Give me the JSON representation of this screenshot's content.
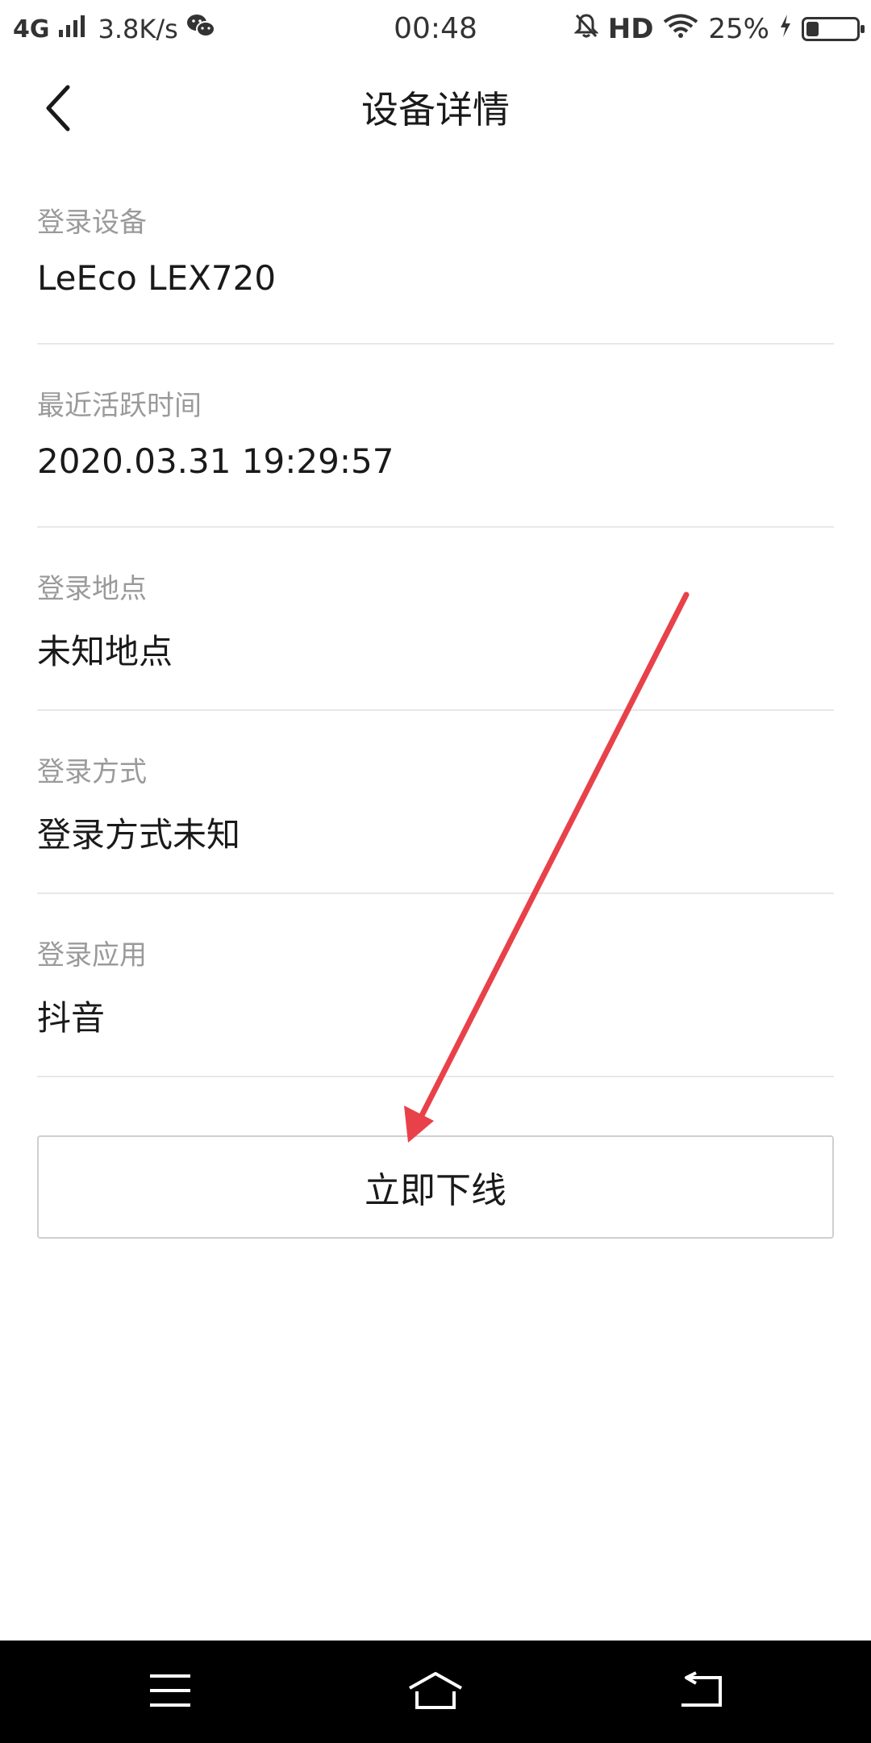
{
  "status_bar": {
    "network": "4G",
    "speed": "3.8K/s",
    "time": "00:48",
    "hd": "HD",
    "battery": "25%",
    "battery_level": 0.25
  },
  "header": {
    "title": "设备详情",
    "back_icon": "chevron-left-icon"
  },
  "details": [
    {
      "label": "登录设备",
      "value": "LeEco LEX720"
    },
    {
      "label": "最近活跃时间",
      "value": "2020.03.31 19:29:57"
    },
    {
      "label": "登录地点",
      "value": "未知地点"
    },
    {
      "label": "登录方式",
      "value": "登录方式未知"
    },
    {
      "label": "登录应用",
      "value": "抖音"
    }
  ],
  "actions": {
    "offline_label": "立即下线"
  },
  "annotation": {
    "arrow_color": "#e8414a"
  },
  "nav": {
    "menu_icon": "menu-icon",
    "home_icon": "home-icon",
    "back_icon": "back-icon"
  }
}
